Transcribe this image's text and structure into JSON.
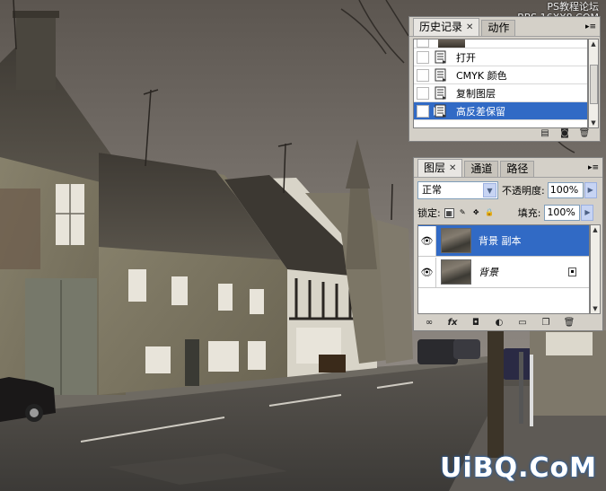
{
  "watermark_top": [
    "PS教程论坛",
    "BBS.16XX8.COM"
  ],
  "watermark_bottom": "UiBQ.CoM",
  "history_panel": {
    "tabs": [
      {
        "label": "历史记录",
        "active": true,
        "closable": true
      },
      {
        "label": "动作",
        "active": false,
        "closable": false
      }
    ],
    "items": [
      {
        "label": "打开",
        "selected": false
      },
      {
        "label": "CMYK 颜色",
        "selected": false
      },
      {
        "label": "复制图层",
        "selected": false
      },
      {
        "label": "高反差保留",
        "selected": true
      }
    ],
    "footer_icons": [
      "new-document-from-state-icon",
      "new-snapshot-icon",
      "trash-icon"
    ]
  },
  "layers_panel": {
    "tabs": [
      {
        "label": "图层",
        "active": true,
        "closable": true
      },
      {
        "label": "通道",
        "active": false,
        "closable": false
      },
      {
        "label": "路径",
        "active": false,
        "closable": false
      }
    ],
    "blend_mode": "正常",
    "opacity_label": "不透明度:",
    "opacity_value": "100%",
    "lock_label": "锁定:",
    "fill_label": "填充:",
    "fill_value": "100%",
    "layers": [
      {
        "name": "背景 副本",
        "selected": true,
        "visible": true,
        "locked": false,
        "italic": false
      },
      {
        "name": "背景",
        "selected": false,
        "visible": true,
        "locked": true,
        "italic": true
      }
    ],
    "footer_icons": [
      "link-icon",
      "fx-icon",
      "mask-icon",
      "adjustment-icon",
      "folder-icon",
      "new-layer-icon",
      "trash-icon"
    ],
    "footer_glyphs": {
      "fx": "fx"
    }
  },
  "colors": {
    "selection": "#316ac5",
    "panel_bg": "#d4d0c8",
    "watermark_glow": "#1a67c5"
  }
}
